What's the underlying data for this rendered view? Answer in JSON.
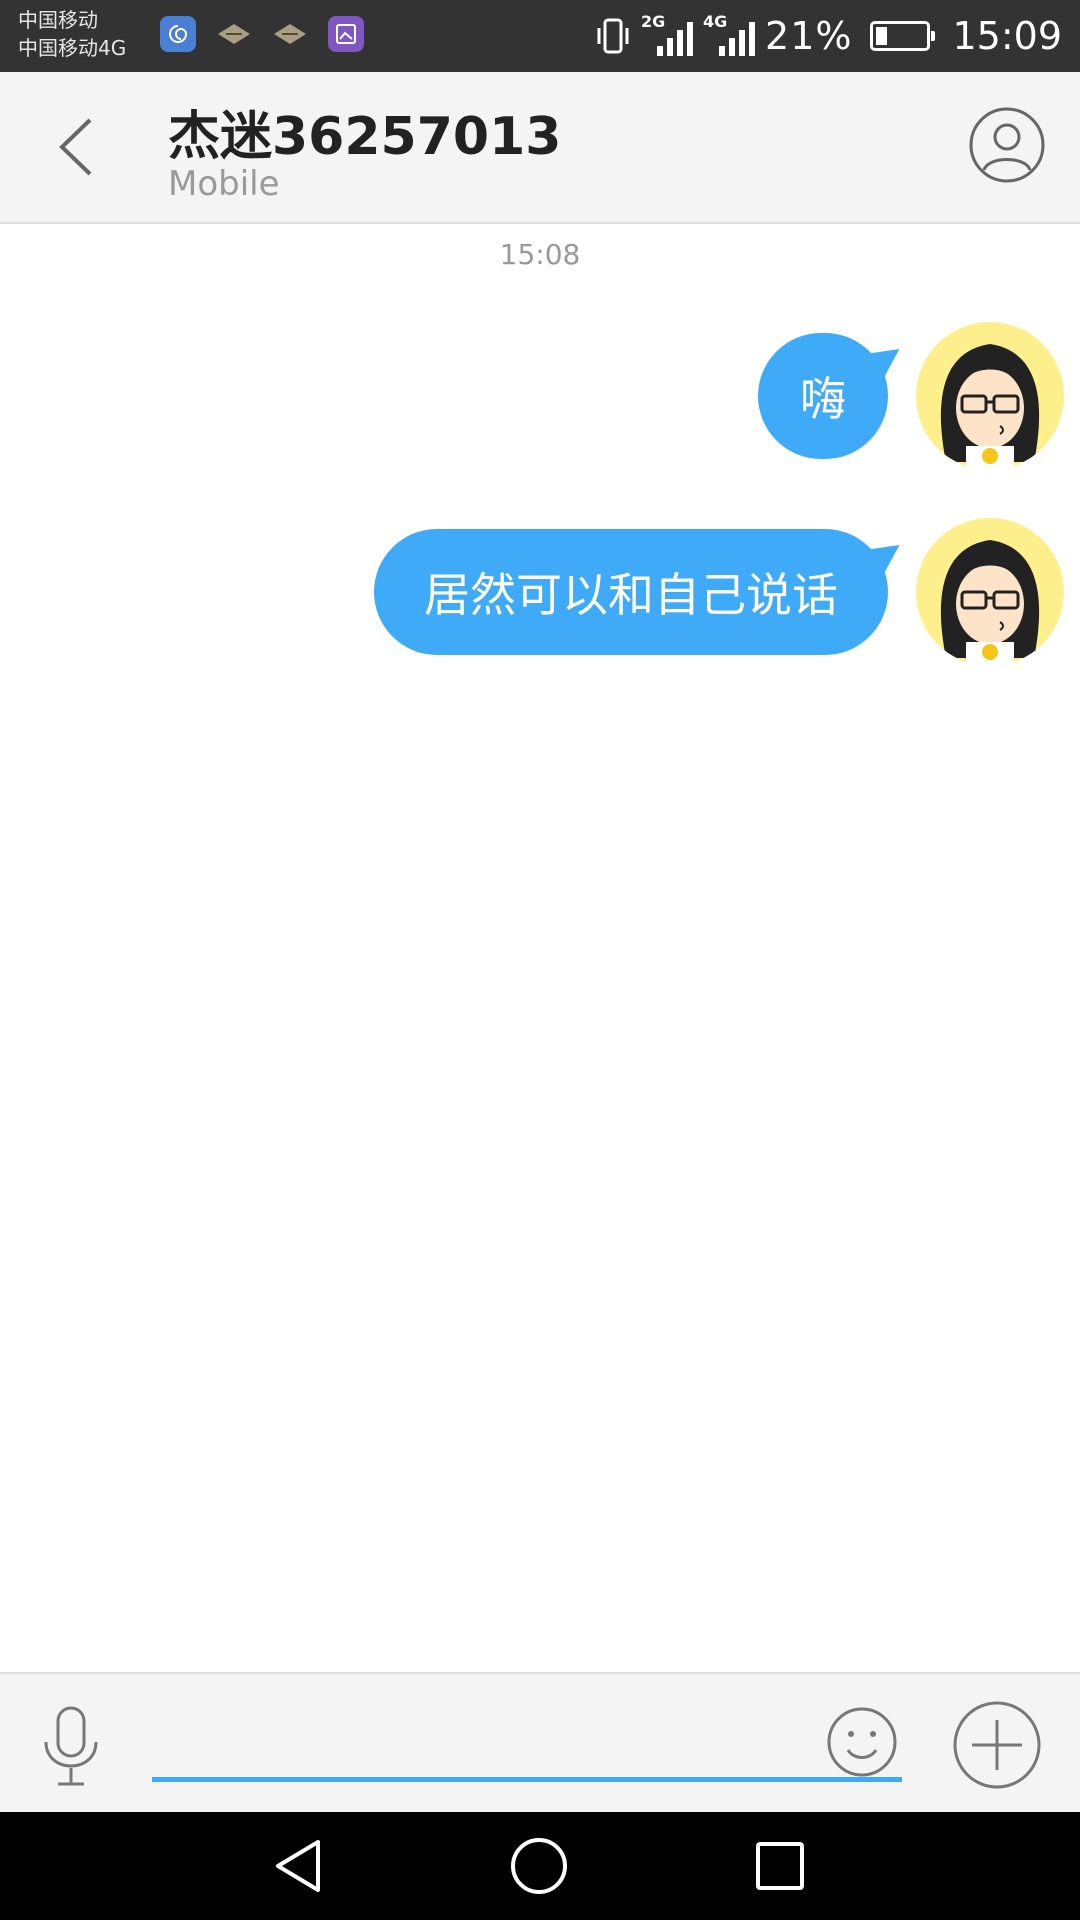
{
  "status_bar": {
    "carrier_1": "中国移动",
    "carrier_2": "中国移动4G",
    "network_1": "2G",
    "network_2": "4G",
    "battery_percent": "21%",
    "battery_level": 0.21,
    "time": "15:09",
    "notification_icons": [
      "swirl-app-icon",
      "fan-icon",
      "fan-icon",
      "photo-icon"
    ]
  },
  "header": {
    "title": "杰迷36257013",
    "subtitle": "Mobile"
  },
  "chat": {
    "timestamp": "15:08",
    "messages": [
      {
        "text": "嗨",
        "sender": "self"
      },
      {
        "text": "居然可以和自己说话",
        "sender": "self"
      }
    ]
  },
  "colors": {
    "accent": "#3eaaf8",
    "statusbar": "#333333",
    "header_bg": "#f4f4f4",
    "avatar_bg": "#fdf08c"
  }
}
